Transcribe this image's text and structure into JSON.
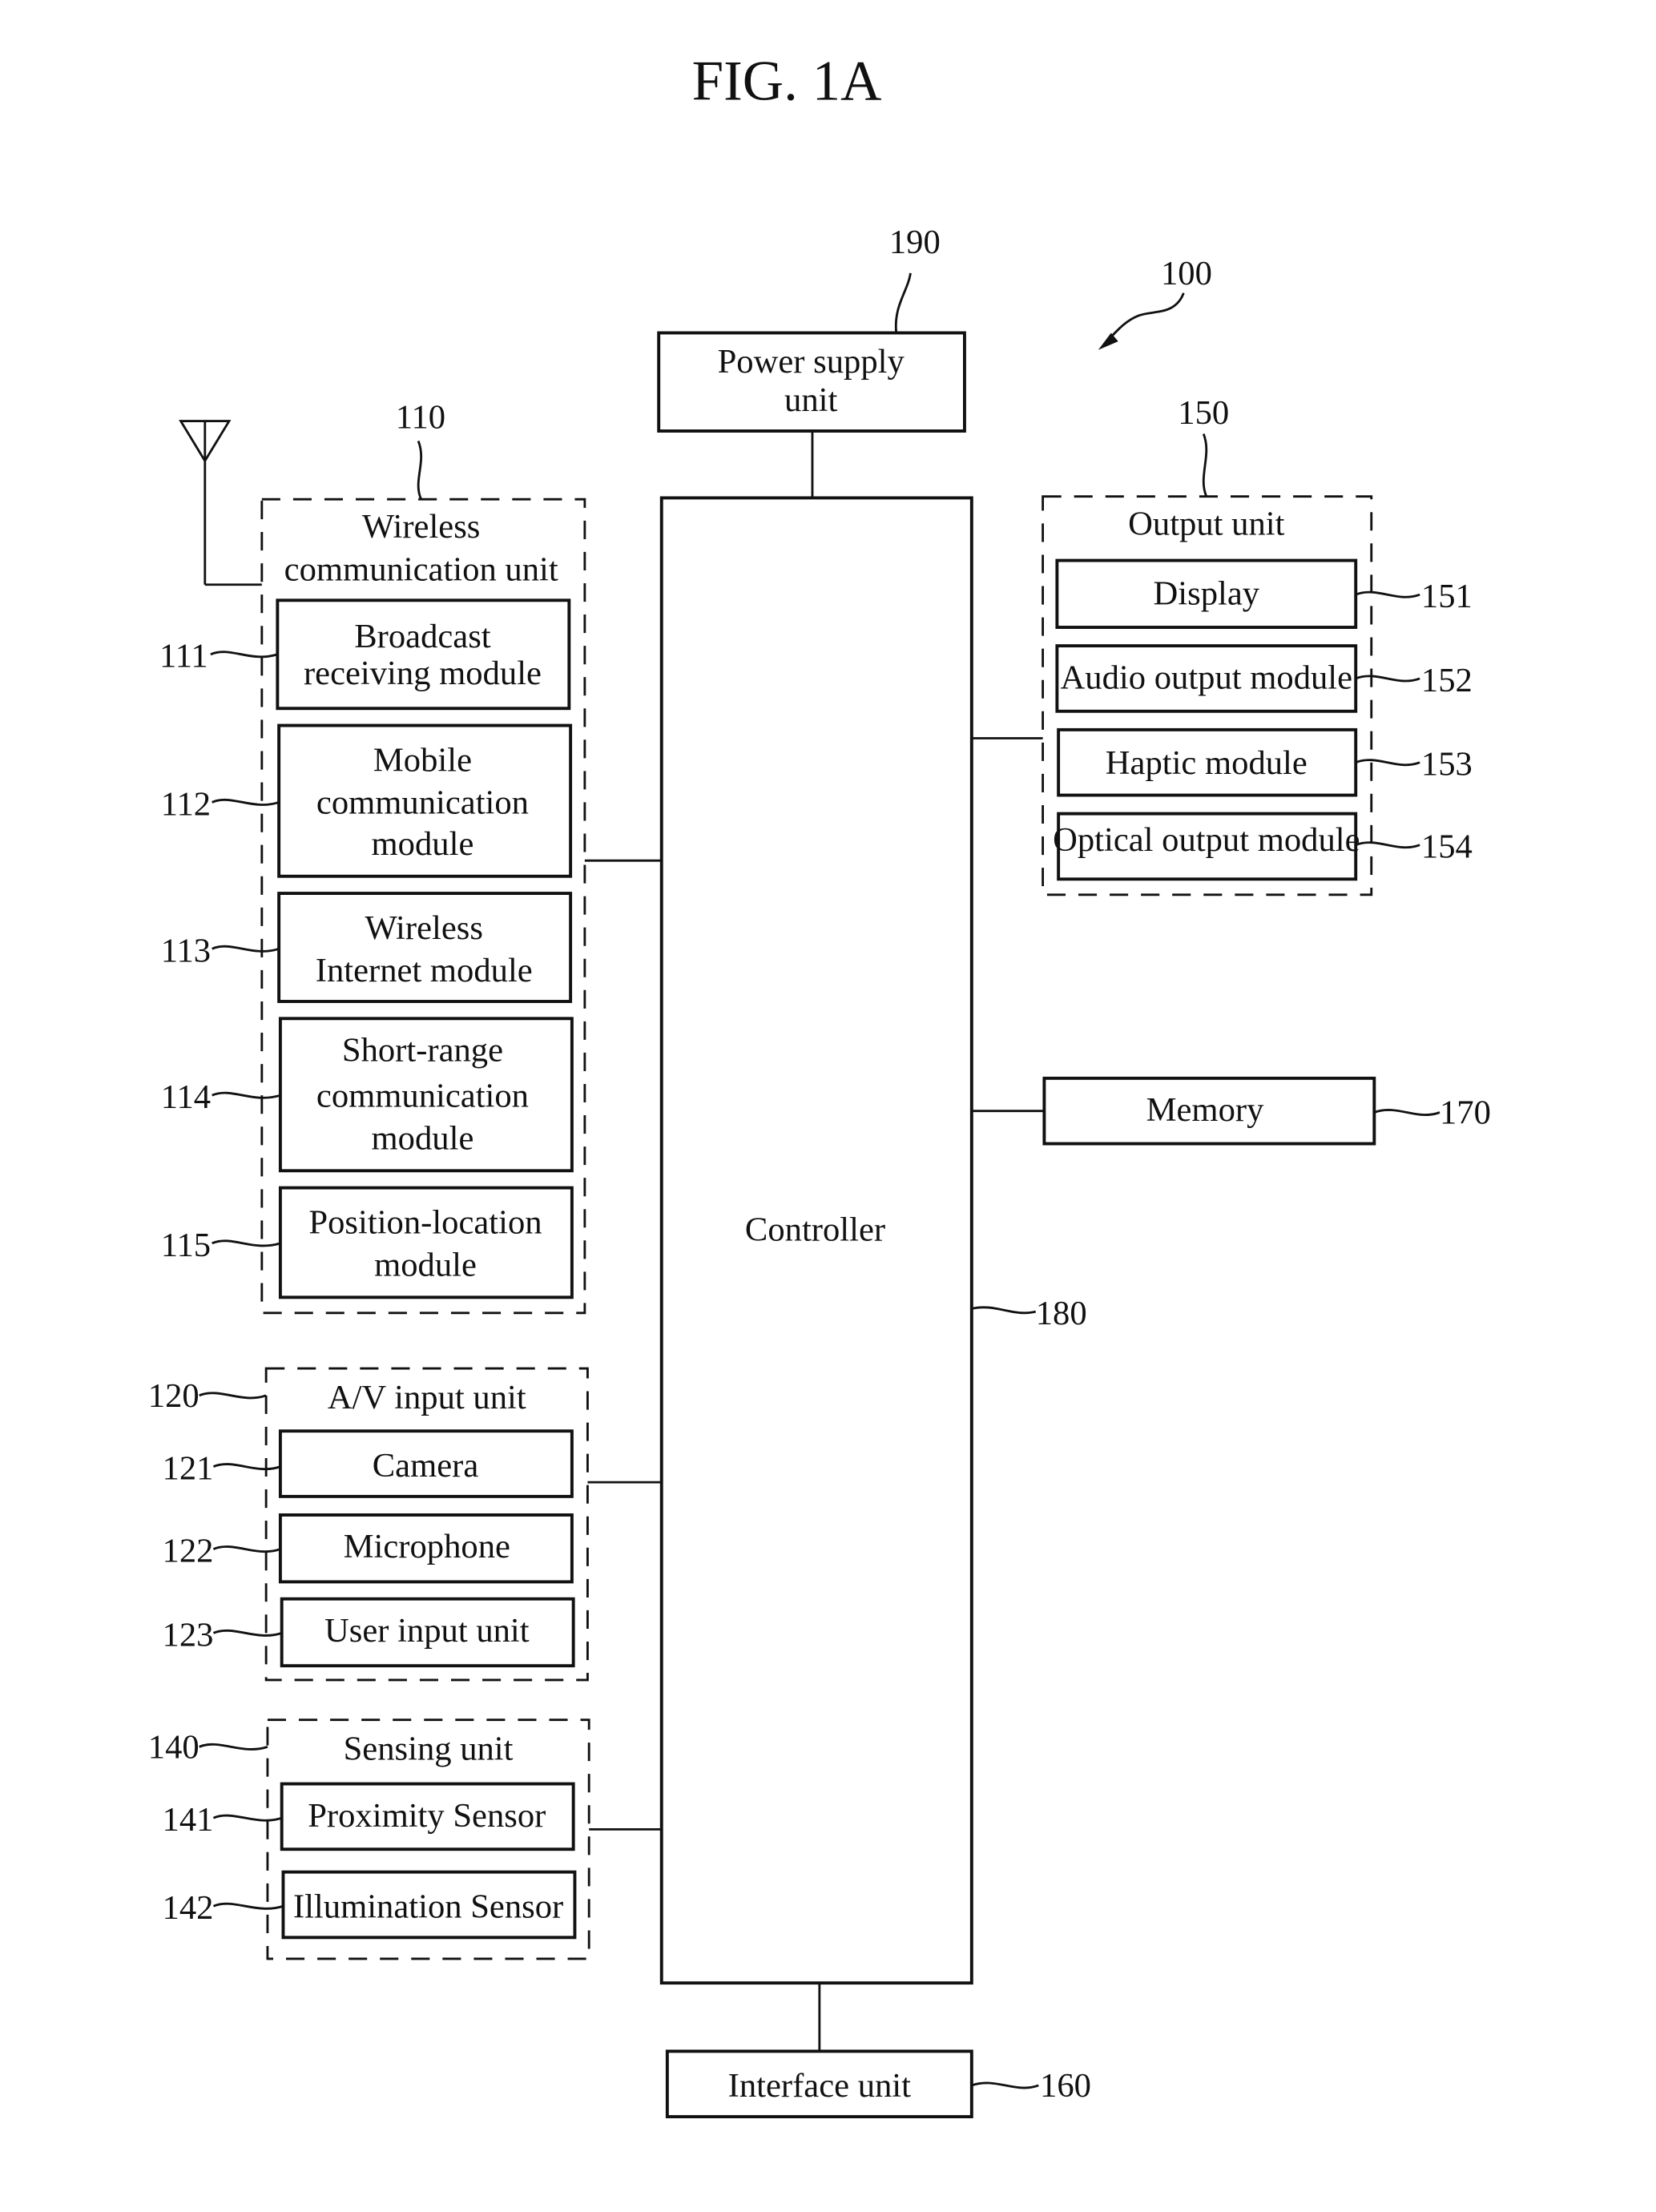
{
  "figure": {
    "title": "FIG. 1A",
    "device_ref": "100"
  },
  "power_supply": {
    "ref": "190",
    "lines": [
      "Power supply",
      "unit"
    ]
  },
  "controller": {
    "ref": "180",
    "label": "Controller"
  },
  "interface_unit": {
    "ref": "160",
    "label": "Interface unit"
  },
  "memory": {
    "ref": "170",
    "label": "Memory"
  },
  "wireless_unit": {
    "ref": "110",
    "lines": [
      "Wireless",
      "communication unit"
    ],
    "modules": [
      {
        "ref": "111",
        "lines": [
          "Broadcast",
          "receiving module"
        ]
      },
      {
        "ref": "112",
        "lines": [
          "Mobile",
          "communication",
          "module"
        ]
      },
      {
        "ref": "113",
        "lines": [
          "Wireless",
          "Internet module"
        ]
      },
      {
        "ref": "114",
        "lines": [
          "Short-range",
          "communication",
          "module"
        ]
      },
      {
        "ref": "115",
        "lines": [
          "Position-location",
          "module"
        ]
      }
    ]
  },
  "av_input_unit": {
    "ref": "120",
    "label": "A/V input unit",
    "modules": [
      {
        "ref": "121",
        "label": "Camera"
      },
      {
        "ref": "122",
        "label": "Microphone"
      },
      {
        "ref": "123",
        "label": "User input unit"
      }
    ]
  },
  "sensing_unit": {
    "ref": "140",
    "label": "Sensing unit",
    "modules": [
      {
        "ref": "141",
        "label": "Proximity Sensor"
      },
      {
        "ref": "142",
        "label": "Illumination Sensor"
      }
    ]
  },
  "output_unit": {
    "ref": "150",
    "label": "Output unit",
    "modules": [
      {
        "ref": "151",
        "label": "Display"
      },
      {
        "ref": "152",
        "label": "Audio output module"
      },
      {
        "ref": "153",
        "label": "Haptic module"
      },
      {
        "ref": "154",
        "label": "Optical output module"
      }
    ]
  }
}
